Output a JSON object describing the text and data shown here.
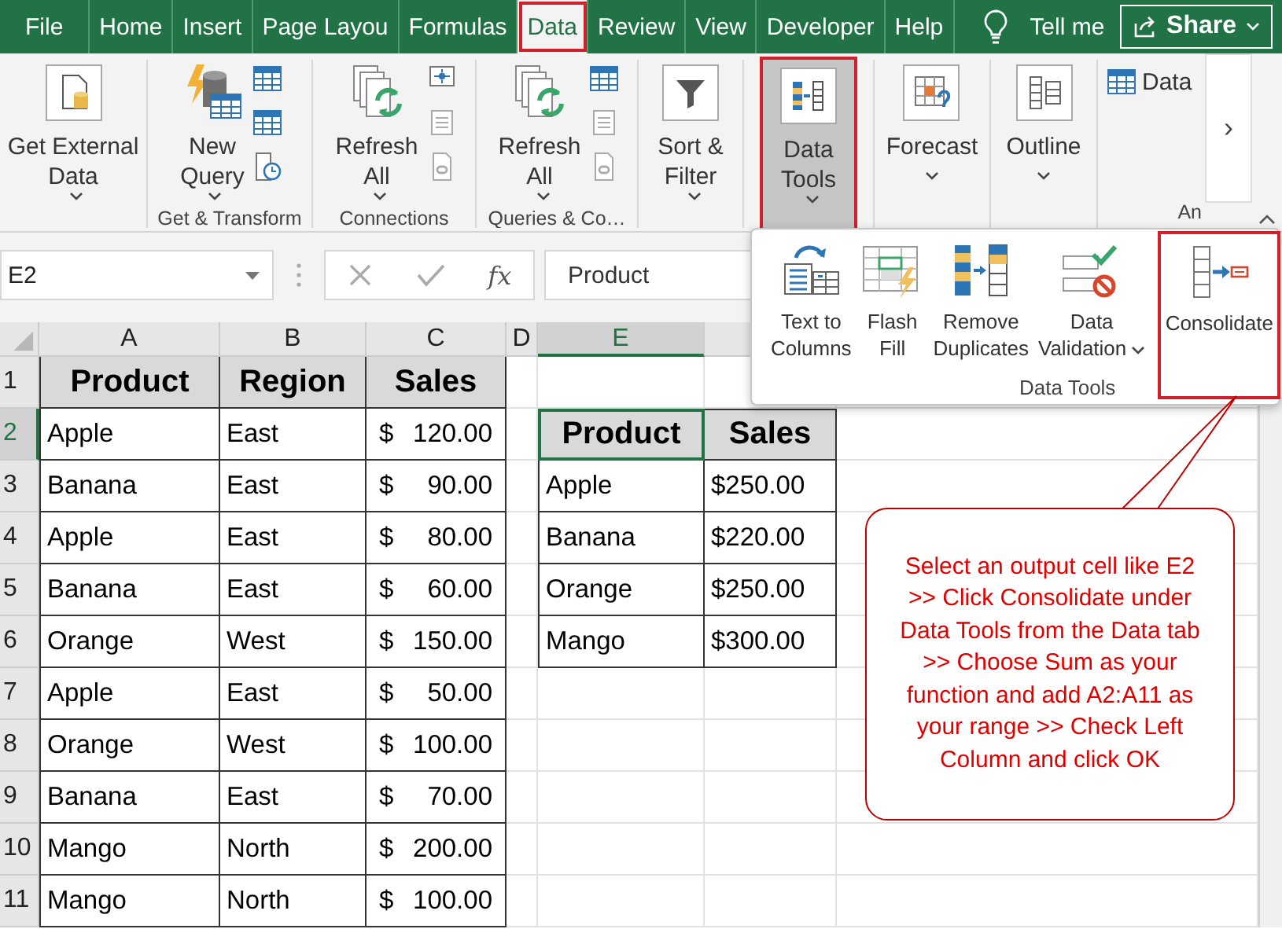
{
  "tabs": [
    {
      "label": "File",
      "selected": false,
      "highlighted": false
    },
    {
      "label": "Home",
      "selected": false,
      "highlighted": false
    },
    {
      "label": "Insert",
      "selected": false,
      "highlighted": false
    },
    {
      "label": "Page Layou",
      "selected": false,
      "highlighted": false
    },
    {
      "label": "Formulas",
      "selected": false,
      "highlighted": false
    },
    {
      "label": "Data",
      "selected": true,
      "highlighted": true
    },
    {
      "label": "Review",
      "selected": false,
      "highlighted": false
    },
    {
      "label": "View",
      "selected": false,
      "highlighted": false
    },
    {
      "label": "Developer",
      "selected": false,
      "highlighted": false
    },
    {
      "label": "Help",
      "selected": false,
      "highlighted": false
    }
  ],
  "tell_me": "Tell me",
  "share": "Share",
  "ribbon": {
    "groups": [
      {
        "buttons": [
          {
            "kind": "large",
            "label": "Get External\nData",
            "has_menu": true,
            "pressed": false,
            "highlighted": false
          }
        ]
      },
      {
        "label": "Get & Transform",
        "buttons": [
          {
            "kind": "large",
            "label": "New\nQuery",
            "has_menu": true,
            "pressed": false,
            "highlighted": false
          }
        ]
      },
      {
        "label": "Connections",
        "buttons": [
          {
            "kind": "large",
            "label": "Refresh\nAll",
            "has_menu": true,
            "pressed": false,
            "highlighted": false
          }
        ]
      },
      {
        "label": "Queries & Co…",
        "buttons": [
          {
            "kind": "large",
            "label": "Refresh\nAll",
            "has_menu": true,
            "pressed": false,
            "highlighted": false
          }
        ]
      },
      {
        "buttons": [
          {
            "kind": "large",
            "label": "Sort &\nFilter",
            "has_menu": true,
            "pressed": false,
            "highlighted": false
          }
        ]
      },
      {
        "buttons": [
          {
            "kind": "large",
            "label": "Data\nTools",
            "has_menu": true,
            "pressed": true,
            "highlighted": true
          }
        ]
      },
      {
        "buttons": [
          {
            "kind": "large",
            "label": "Forecast",
            "has_menu": true,
            "pressed": false,
            "highlighted": false
          }
        ]
      },
      {
        "buttons": [
          {
            "kind": "large",
            "label": "Outline",
            "has_menu": true,
            "pressed": false,
            "highlighted": false
          }
        ]
      },
      {
        "label": "An",
        "buttons": [
          {
            "kind": "small",
            "label": "Data"
          }
        ]
      }
    ],
    "scroll_label": "›"
  },
  "formula_bar": {
    "name_box": "E2",
    "function_label": "fx",
    "formula": "Product"
  },
  "sheet": {
    "columns": [
      {
        "label": "A",
        "selected": false
      },
      {
        "label": "B",
        "selected": false
      },
      {
        "label": "C",
        "selected": false
      },
      {
        "label": "D",
        "selected": false
      },
      {
        "label": "E",
        "selected": true
      }
    ],
    "rows": [
      {
        "label": "1",
        "selected": false
      },
      {
        "label": "2",
        "selected": true
      },
      {
        "label": "3",
        "selected": false
      },
      {
        "label": "4",
        "selected": false
      },
      {
        "label": "5",
        "selected": false
      },
      {
        "label": "6",
        "selected": false
      },
      {
        "label": "7",
        "selected": false
      },
      {
        "label": "8",
        "selected": false
      },
      {
        "label": "9",
        "selected": false
      },
      {
        "label": "10",
        "selected": false
      },
      {
        "label": "11",
        "selected": false
      }
    ]
  },
  "sales_table": {
    "columns": [
      "Product",
      "Region",
      "Sales"
    ],
    "rows": [
      {
        "product": "Apple",
        "region": "East",
        "currency": "$",
        "amount": "120.00"
      },
      {
        "product": "Banana",
        "region": "East",
        "currency": "$",
        "amount": "90.00"
      },
      {
        "product": "Apple",
        "region": "East",
        "currency": "$",
        "amount": "80.00"
      },
      {
        "product": "Banana",
        "region": "East",
        "currency": "$",
        "amount": "60.00"
      },
      {
        "product": "Orange",
        "region": "West",
        "currency": "$",
        "amount": "150.00"
      },
      {
        "product": "Apple",
        "region": "East",
        "currency": "$",
        "amount": "50.00"
      },
      {
        "product": "Orange",
        "region": "West",
        "currency": "$",
        "amount": "100.00"
      },
      {
        "product": "Banana",
        "region": "East",
        "currency": "$",
        "amount": "70.00"
      },
      {
        "product": "Mango",
        "region": "North",
        "currency": "$",
        "amount": "200.00"
      },
      {
        "product": "Mango",
        "region": "North",
        "currency": "$",
        "amount": "100.00"
      }
    ]
  },
  "summary_table": {
    "columns": [
      {
        "label": "Product",
        "selected": true
      },
      {
        "label": "Sales",
        "selected": false
      }
    ],
    "rows": [
      {
        "product": "Apple",
        "sales": "$250.00"
      },
      {
        "product": "Banana",
        "sales": "$220.00"
      },
      {
        "product": "Orange",
        "sales": "$250.00"
      },
      {
        "product": "Mango",
        "sales": "$300.00"
      }
    ]
  },
  "data_tools_menu": {
    "label": "Data Tools",
    "items": [
      {
        "label": "Text to\nColumns",
        "has_menu": false,
        "highlighted": false
      },
      {
        "label": "Flash\nFill",
        "has_menu": false,
        "highlighted": false
      },
      {
        "label": "Remove\nDuplicates",
        "has_menu": false,
        "highlighted": false
      },
      {
        "label": "Data\nValidation",
        "has_menu": true,
        "highlighted": false
      },
      {
        "label": "Consolidate",
        "has_menu": false,
        "highlighted": true
      }
    ]
  },
  "callout": {
    "text": "Select an output cell like E2 >> Click Consolidate under Data Tools from the Data tab >> Choose Sum as your function and add A2:A11 as your range >> Check Left Column and click OK"
  }
}
